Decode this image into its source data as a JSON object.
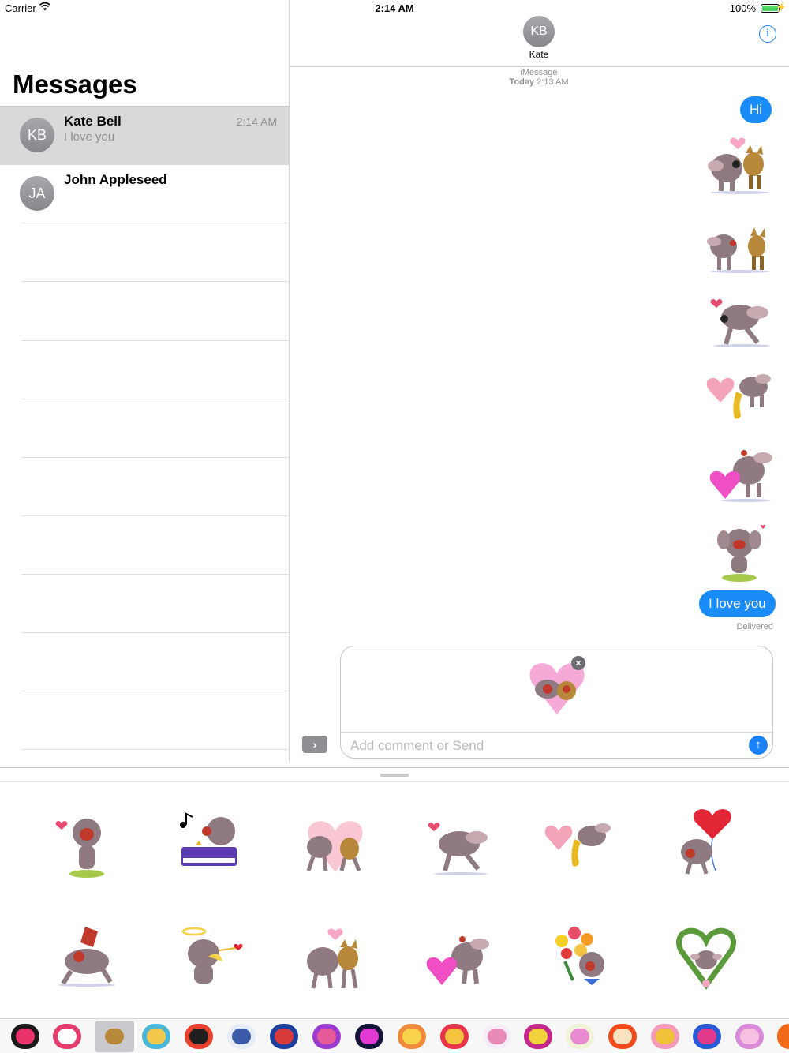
{
  "status": {
    "carrier": "Carrier",
    "time": "2:14 AM",
    "battery": "100%"
  },
  "messages_list": {
    "title": "Messages",
    "conversations": [
      {
        "initials": "KB",
        "name": "Kate Bell",
        "preview": "I love you",
        "time": "2:14 AM"
      },
      {
        "initials": "JA",
        "name": "John Appleseed",
        "preview": "",
        "time": ""
      }
    ]
  },
  "thread": {
    "contact_initials": "KB",
    "contact_name": "Kate",
    "info_icon": "info-icon",
    "service": "iMessage",
    "timestamp_day": "Today",
    "timestamp_time": "2:13 AM",
    "bubble_hi": "Hi",
    "bubble_love": "I love you",
    "delivered": "Delivered",
    "compose_placeholder": "Add comment or Send",
    "send_icon": "↑",
    "expand_icon": "›",
    "remove_icon": "×"
  },
  "colors": {
    "bubble": "#1a8cf7",
    "accent": "#1a82fb",
    "selected_row": "#d9d9d9"
  }
}
